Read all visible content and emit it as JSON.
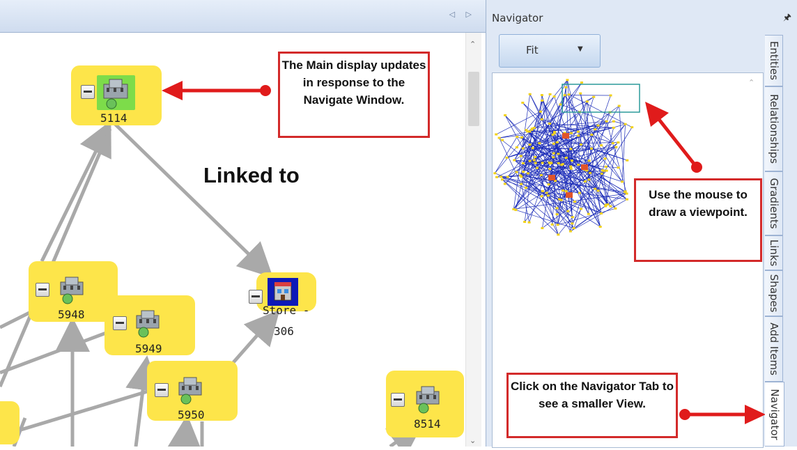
{
  "navigator": {
    "title": "Navigator",
    "fit_label": "Fit",
    "pin_icon": "pin-icon"
  },
  "side_tabs": [
    {
      "label": "Entities"
    },
    {
      "label": "Relationships"
    },
    {
      "label": "Gradients"
    },
    {
      "label": "Links"
    },
    {
      "label": "Shapes"
    },
    {
      "label": "Add Items"
    },
    {
      "label": "Navigator"
    }
  ],
  "graph": {
    "title": "Linked to",
    "nodes": [
      {
        "label": "5114",
        "icon": "building-icon"
      },
      {
        "label": "5948",
        "icon": "building-icon"
      },
      {
        "label": "5949",
        "icon": "building-icon"
      },
      {
        "label": "5950",
        "icon": "building-icon"
      },
      {
        "label": "Store -",
        "label2": "306",
        "icon": "store-icon"
      },
      {
        "label": "8514",
        "icon": "building-icon"
      }
    ]
  },
  "callouts": {
    "main_display": "The Main display updates in response to the Navigate Window.",
    "mouse": "Use the mouse to draw a viewpoint.",
    "navigator_tab": "Click on the Navigator Tab to see a smaller View."
  },
  "colors": {
    "node_fill": "#fde54a",
    "callout_border": "#d32a2a",
    "arrow": "#e01b1b",
    "edge": "#a9a9a9",
    "panel_bg": "#dfe8f5"
  }
}
